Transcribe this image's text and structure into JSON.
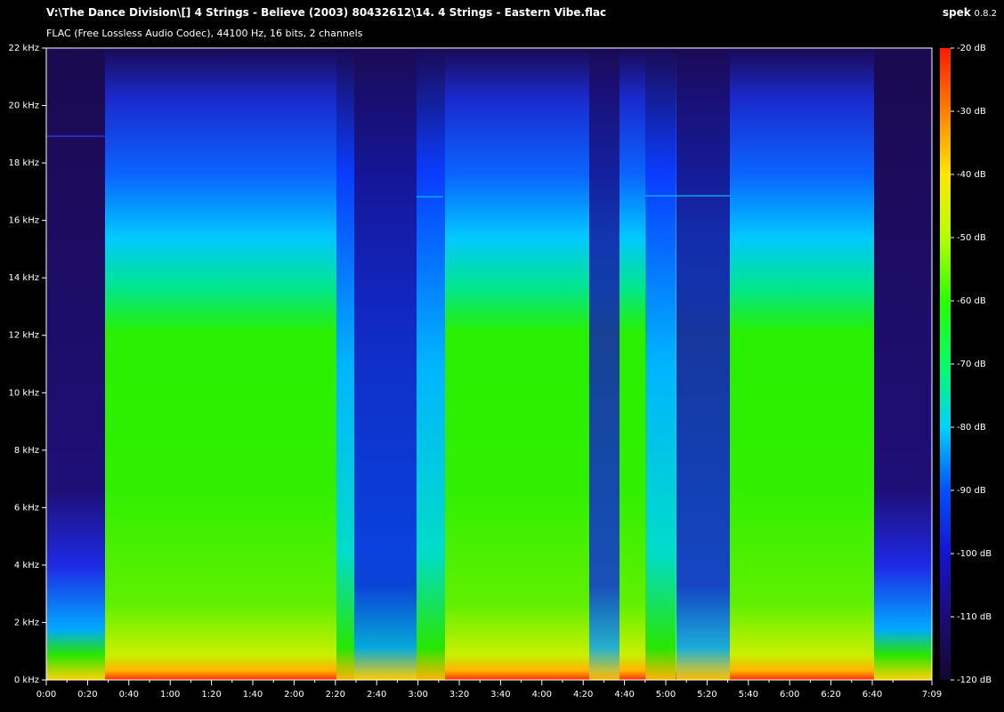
{
  "app": {
    "name": "spek",
    "version": "0.8.2"
  },
  "file": {
    "path": "V:\\The Dance Division\\[] 4 Strings - Believe (2003) 80432612\\14. 4 Strings - Eastern Vibe.flac",
    "info": "FLAC (Free Lossless Audio Codec), 44100 Hz, 16 bits, 2 channels"
  },
  "frequency_axis": {
    "labels": [
      "22 kHz",
      "20 kHz",
      "18 kHz",
      "16 kHz",
      "14 kHz",
      "12 kHz",
      "10 kHz",
      "8 kHz",
      "6 kHz",
      "4 kHz",
      "2 kHz",
      "0 kHz"
    ]
  },
  "time_axis": {
    "labels": [
      "0:00",
      "0:20",
      "0:40",
      "1:00",
      "1:20",
      "1:40",
      "2:00",
      "2:20",
      "2:40",
      "3:00",
      "3:20",
      "3:40",
      "4:00",
      "4:20",
      "4:40",
      "5:00",
      "5:20",
      "5:40",
      "6:00",
      "6:20",
      "6:40",
      "7:09"
    ]
  },
  "level_axis": {
    "labels": [
      "-20 dB",
      "-30 dB",
      "-40 dB",
      "-50 dB",
      "-60 dB",
      "-70 dB",
      "-80 dB",
      "-90 dB",
      "-100 dB",
      "-110 dB",
      "-120 dB"
    ]
  },
  "colors": {
    "background": "#000000",
    "scale": [
      "#ff1a00",
      "#ff8000",
      "#ffe600",
      "#b4ff00",
      "#28ff00",
      "#00ff64",
      "#00d2ff",
      "#0050ff",
      "#1414d2",
      "#1e0a78",
      "#140632"
    ]
  }
}
